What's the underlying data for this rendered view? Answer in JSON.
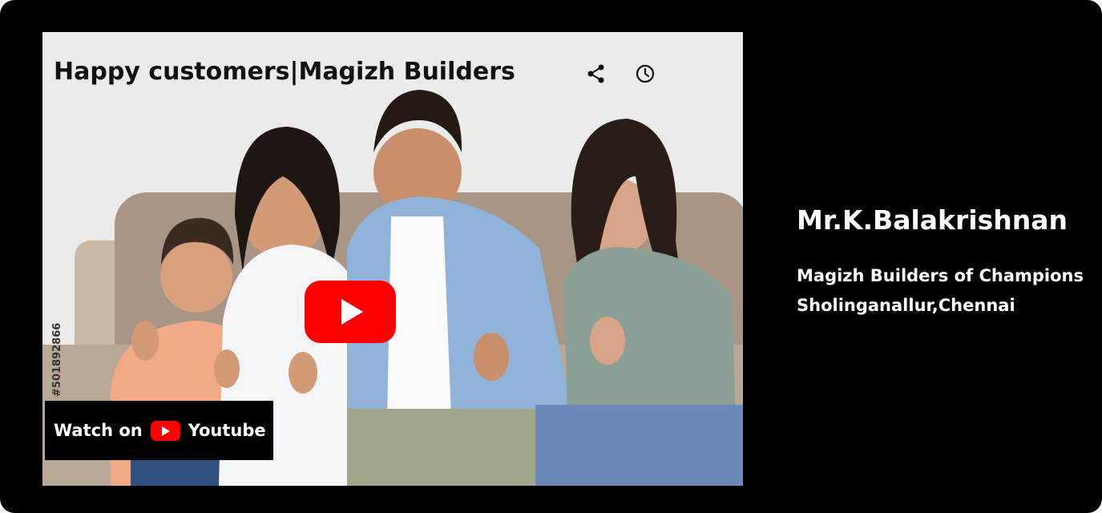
{
  "video": {
    "title": "Happy customers|Magizh Builders",
    "watch_on_label": "Watch on",
    "platform_label": "Youtube",
    "stock_id": "#501892866",
    "share_icon": "share-icon",
    "clock_icon": "clock-icon",
    "play_icon": "youtube-play-icon"
  },
  "testimonial": {
    "name": "Mr.K.Balakrishnan",
    "company": "Magizh Builders of Champions",
    "location": "Sholinganallur,Chennai"
  },
  "colors": {
    "background": "#000000",
    "youtube_red": "#ff0000",
    "text": "#ffffff"
  }
}
